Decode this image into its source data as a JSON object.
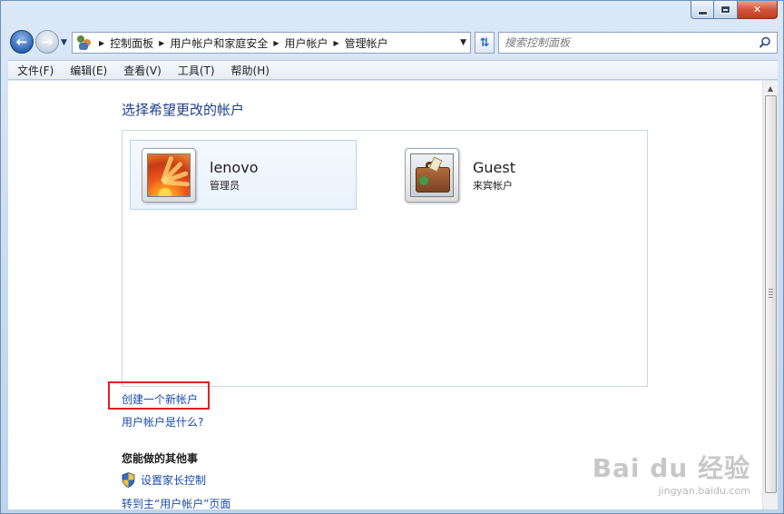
{
  "window": {
    "caption_buttons": {
      "minimize": "minimize",
      "maximize": "maximize",
      "close": "✕"
    }
  },
  "navigation": {
    "breadcrumbs": [
      "控制面板",
      "用户帐户和家庭安全",
      "用户帐户",
      "管理帐户"
    ],
    "search_placeholder": "搜索控制面板"
  },
  "menu": {
    "items": [
      "文件(F)",
      "编辑(E)",
      "查看(V)",
      "工具(T)",
      "帮助(H)"
    ]
  },
  "main": {
    "title": "选择希望更改的帐户",
    "accounts": [
      {
        "name": "lenovo",
        "role": "管理员",
        "avatar": "flower-avatar-icon"
      },
      {
        "name": "Guest",
        "role": "来宾帐户",
        "avatar": "briefcase-avatar-icon"
      }
    ],
    "create_link": "创建一个新帐户",
    "what_link": "用户帐户是什么?",
    "other_heading": "您能做的其他事",
    "tasks": [
      {
        "label": "设置家长控制",
        "icon": "shield-icon"
      },
      {
        "label": "转到主“用户帐户”页面"
      }
    ]
  },
  "watermark": {
    "logo": "Bai du 经验",
    "url": "jingyan.baidu.com"
  },
  "colors": {
    "link": "#1a4da8",
    "title": "#1e3f8c",
    "highlight": "#e02020",
    "chrome": "#c8daf0"
  }
}
